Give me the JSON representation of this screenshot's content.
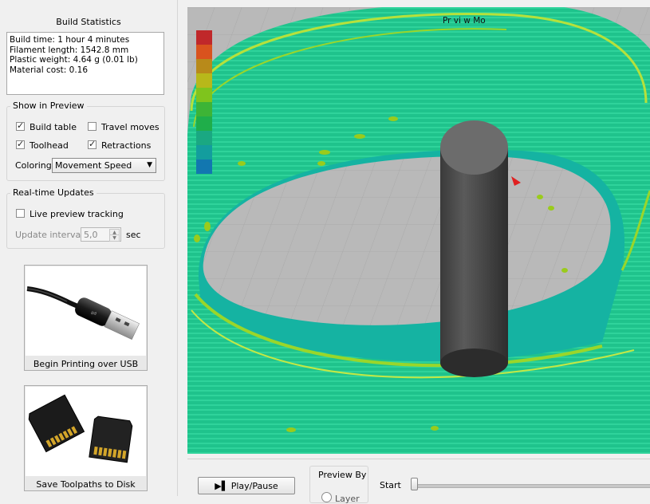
{
  "build_statistics": {
    "title": "Build Statistics",
    "lines": [
      "Build time: 1 hour 4 minutes",
      "Filament length: 1542.8 mm",
      "Plastic weight: 4.64 g (0.01 lb)",
      "Material cost: 0.16"
    ]
  },
  "show_in_preview": {
    "title": "Show in Preview",
    "build_table": {
      "label": "Build table",
      "checked": true
    },
    "travel_moves": {
      "label": "Travel moves",
      "checked": false
    },
    "toolhead": {
      "label": "Toolhead",
      "checked": true
    },
    "retractions": {
      "label": "Retractions",
      "checked": true
    },
    "coloring_label": "Coloring",
    "coloring_value": "Movement Speed"
  },
  "realtime_updates": {
    "title": "Real-time Updates",
    "live_preview": {
      "label": "Live preview tracking",
      "checked": false
    },
    "interval_label": "Update interval",
    "interval_value": "5,0",
    "interval_unit": "sec"
  },
  "actions": {
    "usb_label": "Begin Printing over USB",
    "disk_label": "Save Toolpaths to Disk"
  },
  "preview": {
    "title": "Pr  vi  w Mo",
    "legend_colors": [
      "#c0282a",
      "#d9531e",
      "#b88a1a",
      "#b8b81a",
      "#7fc41d",
      "#3db436",
      "#1fae4a",
      "#1aa882",
      "#139d9e",
      "#1277b0"
    ]
  },
  "bottom_bar": {
    "play_label": "Play/Pause",
    "preview_by_title": "Preview By",
    "preview_by_option": "Layer",
    "start_label": "Start",
    "start_value": 0
  }
}
